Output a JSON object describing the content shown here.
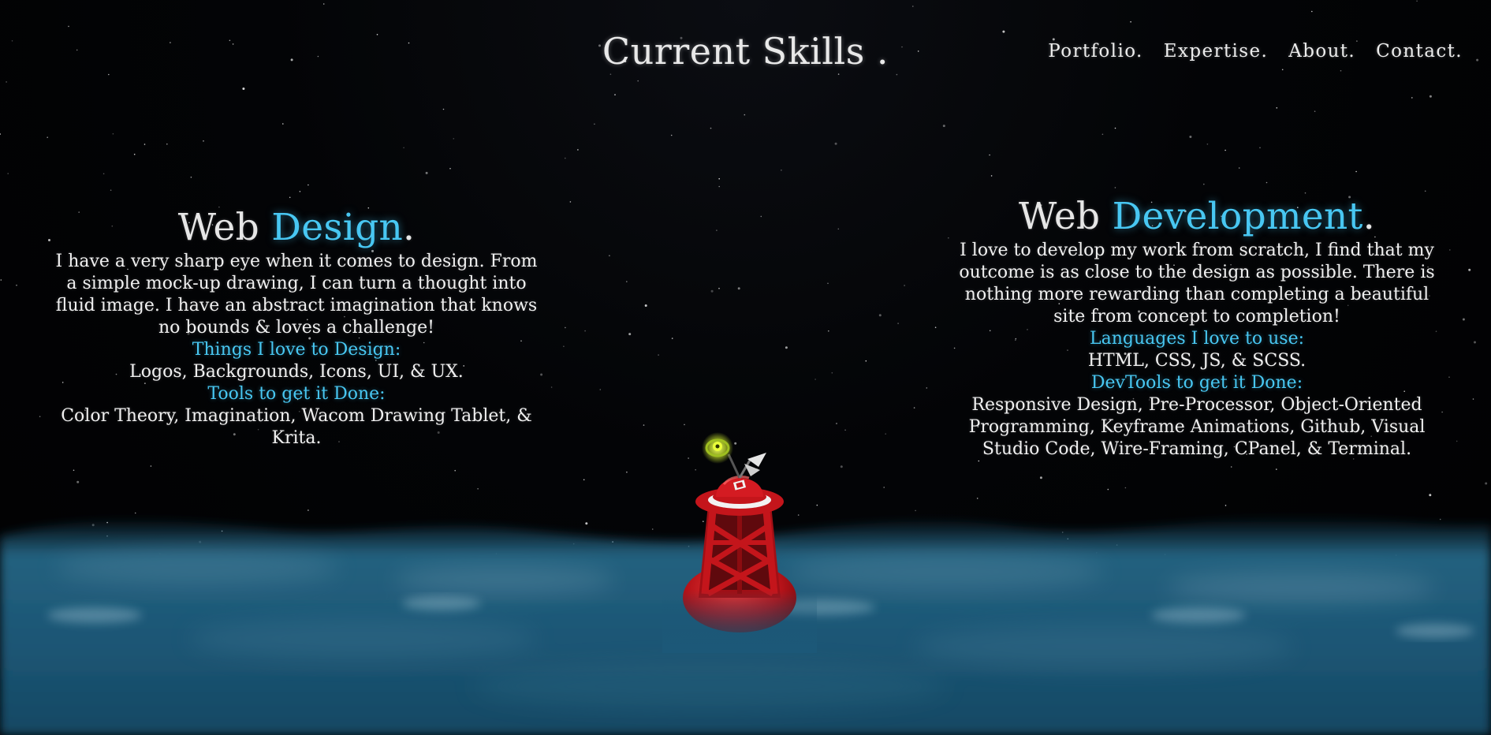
{
  "header": {
    "title": "Current Skills ."
  },
  "nav": {
    "items": [
      {
        "label": "Portfolio."
      },
      {
        "label": "Expertise."
      },
      {
        "label": "About."
      },
      {
        "label": "Contact."
      }
    ]
  },
  "web_design": {
    "title_main": "Web ",
    "title_accent": "Design",
    "title_dot": ".",
    "description": "I have a very sharp eye when it comes to design. From a simple mock-up drawing, I can turn a thought into fluid image. I have an abstract imagination that knows no bounds & loves a challenge!",
    "things_heading": "Things I love to Design:",
    "things_list": "Logos, Backgrounds, Icons, UI, & UX.",
    "tools_heading": "Tools to get it Done:",
    "tools_list": "Color Theory, Imagination, Wacom Drawing Tablet, & Krita."
  },
  "web_development": {
    "title_main": "Web ",
    "title_accent": "Development",
    "title_dot": ".",
    "description": "I love to develop my work from scratch, I find that my outcome is as close to the design as possible. There is nothing more rewarding than completing a beautiful site from concept to completion!",
    "languages_heading": "Languages I love to use:",
    "languages_list": "HTML, CSS, JS, & SCSS.",
    "devtools_heading": "DevTools to get it Done:",
    "devtools_list": "Responsive Design, Pre-Processor, Object-Oriented Programming, Keyframe Animations, Github, Visual Studio Code, Wire-Framing, CPanel, & Terminal."
  },
  "colors": {
    "accent": "#48c7f2",
    "background": "#020305",
    "text": "#f0f0f0",
    "ocean": "#1d5a77",
    "buoy_red": "#c4151b"
  },
  "icons": {
    "buoy": "bell-buoy-illustration"
  }
}
